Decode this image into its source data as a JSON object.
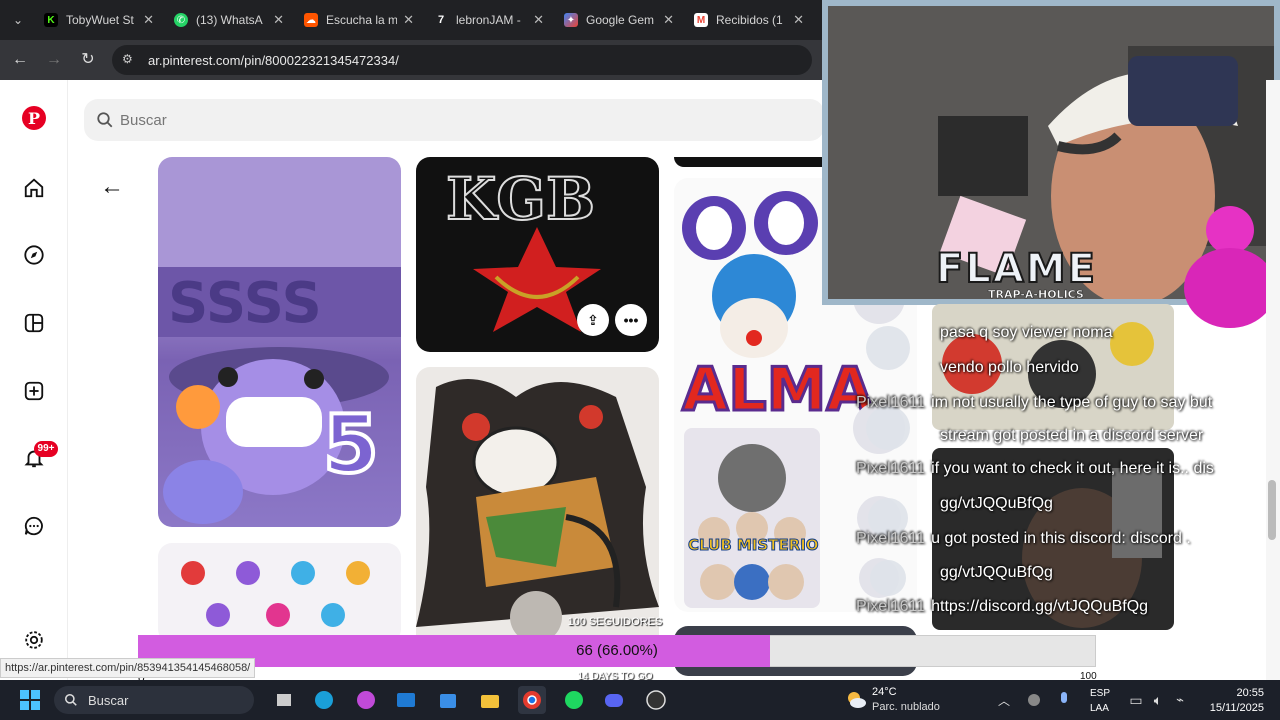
{
  "browser": {
    "tabs": [
      {
        "title": "TobyWuet St",
        "favicon": "kick-logo",
        "color": "#53fc18"
      },
      {
        "title": "(13) WhatsA",
        "favicon": "whatsapp-logo",
        "color": "#25d366"
      },
      {
        "title": "Escucha la m",
        "favicon": "soundcloud-logo",
        "color": "#ff5500"
      },
      {
        "title": "lebronJAM -",
        "favicon": "seventv-logo",
        "color": "#ffffff"
      },
      {
        "title": "Google Gem",
        "favicon": "gemini-logo",
        "color": "#4285f4"
      },
      {
        "title": "Recibidos (1",
        "favicon": "gmail-logo",
        "color": "#ea4335"
      }
    ],
    "url": "ar.pinterest.com/pin/800022321345472334/",
    "status_url": "https://ar.pinterest.com/pin/853941354145468058/"
  },
  "pinterest": {
    "search_placeholder": "Buscar",
    "notifications_badge": "99+",
    "pins": {
      "kgb_text": "KGB",
      "alma_text": "ALMA",
      "club_text": "CLUB MISTERIO"
    }
  },
  "overlay": {
    "banner_title": "FLAME",
    "banner_sub": "TRAP-A-HOLICS",
    "chat": [
      {
        "name": "",
        "text": "pasa q soy viewer noma"
      },
      {
        "name": "",
        "text": "vendo pollo hervido"
      },
      {
        "name": "Pixel1611",
        "text": "im not usually the type of guy to say but"
      },
      {
        "name": "",
        "text": "stream got posted in a discord server"
      },
      {
        "name": "Pixel1611",
        "text": "if you want to check it out, here it is.. dis"
      },
      {
        "name": "",
        "text": "gg/vtJQQuBfQg"
      },
      {
        "name": "Pixel1611",
        "text": "u got posted in this discord: discord ."
      },
      {
        "name": "",
        "text": "gg/vtJQQuBfQg"
      },
      {
        "name": "Pixel1611",
        "text": "https://discord.gg/vtJQQuBfQg"
      }
    ],
    "progress": {
      "label": "66 (66.00%)",
      "goal_title": "100 SEGUIDORES",
      "remaining": "14 DAYS TO GO",
      "min": "0",
      "max": "100",
      "fraction": 0.66,
      "fill_color": "#d25ce0"
    }
  },
  "taskbar": {
    "search_placeholder": "Buscar",
    "weather_temp": "24°C",
    "weather_desc": "Parc. nublado",
    "lang1": "ESP",
    "lang2": "LAA",
    "time": "20:55",
    "date": "15/11/2025"
  }
}
